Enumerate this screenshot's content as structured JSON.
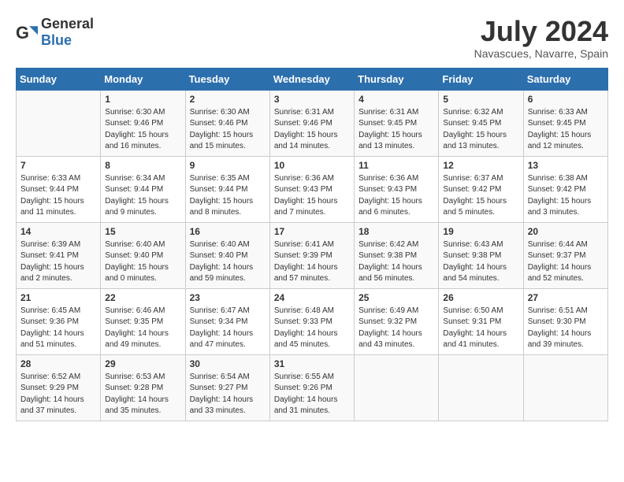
{
  "logo": {
    "text_general": "General",
    "text_blue": "Blue"
  },
  "title": "July 2024",
  "subtitle": "Navascues, Navarre, Spain",
  "days_of_week": [
    "Sunday",
    "Monday",
    "Tuesday",
    "Wednesday",
    "Thursday",
    "Friday",
    "Saturday"
  ],
  "weeks": [
    [
      {
        "day": "",
        "info": ""
      },
      {
        "day": "1",
        "info": "Sunrise: 6:30 AM\nSunset: 9:46 PM\nDaylight: 15 hours\nand 16 minutes."
      },
      {
        "day": "2",
        "info": "Sunrise: 6:30 AM\nSunset: 9:46 PM\nDaylight: 15 hours\nand 15 minutes."
      },
      {
        "day": "3",
        "info": "Sunrise: 6:31 AM\nSunset: 9:46 PM\nDaylight: 15 hours\nand 14 minutes."
      },
      {
        "day": "4",
        "info": "Sunrise: 6:31 AM\nSunset: 9:45 PM\nDaylight: 15 hours\nand 13 minutes."
      },
      {
        "day": "5",
        "info": "Sunrise: 6:32 AM\nSunset: 9:45 PM\nDaylight: 15 hours\nand 13 minutes."
      },
      {
        "day": "6",
        "info": "Sunrise: 6:33 AM\nSunset: 9:45 PM\nDaylight: 15 hours\nand 12 minutes."
      }
    ],
    [
      {
        "day": "7",
        "info": "Sunrise: 6:33 AM\nSunset: 9:44 PM\nDaylight: 15 hours\nand 11 minutes."
      },
      {
        "day": "8",
        "info": "Sunrise: 6:34 AM\nSunset: 9:44 PM\nDaylight: 15 hours\nand 9 minutes."
      },
      {
        "day": "9",
        "info": "Sunrise: 6:35 AM\nSunset: 9:44 PM\nDaylight: 15 hours\nand 8 minutes."
      },
      {
        "day": "10",
        "info": "Sunrise: 6:36 AM\nSunset: 9:43 PM\nDaylight: 15 hours\nand 7 minutes."
      },
      {
        "day": "11",
        "info": "Sunrise: 6:36 AM\nSunset: 9:43 PM\nDaylight: 15 hours\nand 6 minutes."
      },
      {
        "day": "12",
        "info": "Sunrise: 6:37 AM\nSunset: 9:42 PM\nDaylight: 15 hours\nand 5 minutes."
      },
      {
        "day": "13",
        "info": "Sunrise: 6:38 AM\nSunset: 9:42 PM\nDaylight: 15 hours\nand 3 minutes."
      }
    ],
    [
      {
        "day": "14",
        "info": "Sunrise: 6:39 AM\nSunset: 9:41 PM\nDaylight: 15 hours\nand 2 minutes."
      },
      {
        "day": "15",
        "info": "Sunrise: 6:40 AM\nSunset: 9:40 PM\nDaylight: 15 hours\nand 0 minutes."
      },
      {
        "day": "16",
        "info": "Sunrise: 6:40 AM\nSunset: 9:40 PM\nDaylight: 14 hours\nand 59 minutes."
      },
      {
        "day": "17",
        "info": "Sunrise: 6:41 AM\nSunset: 9:39 PM\nDaylight: 14 hours\nand 57 minutes."
      },
      {
        "day": "18",
        "info": "Sunrise: 6:42 AM\nSunset: 9:38 PM\nDaylight: 14 hours\nand 56 minutes."
      },
      {
        "day": "19",
        "info": "Sunrise: 6:43 AM\nSunset: 9:38 PM\nDaylight: 14 hours\nand 54 minutes."
      },
      {
        "day": "20",
        "info": "Sunrise: 6:44 AM\nSunset: 9:37 PM\nDaylight: 14 hours\nand 52 minutes."
      }
    ],
    [
      {
        "day": "21",
        "info": "Sunrise: 6:45 AM\nSunset: 9:36 PM\nDaylight: 14 hours\nand 51 minutes."
      },
      {
        "day": "22",
        "info": "Sunrise: 6:46 AM\nSunset: 9:35 PM\nDaylight: 14 hours\nand 49 minutes."
      },
      {
        "day": "23",
        "info": "Sunrise: 6:47 AM\nSunset: 9:34 PM\nDaylight: 14 hours\nand 47 minutes."
      },
      {
        "day": "24",
        "info": "Sunrise: 6:48 AM\nSunset: 9:33 PM\nDaylight: 14 hours\nand 45 minutes."
      },
      {
        "day": "25",
        "info": "Sunrise: 6:49 AM\nSunset: 9:32 PM\nDaylight: 14 hours\nand 43 minutes."
      },
      {
        "day": "26",
        "info": "Sunrise: 6:50 AM\nSunset: 9:31 PM\nDaylight: 14 hours\nand 41 minutes."
      },
      {
        "day": "27",
        "info": "Sunrise: 6:51 AM\nSunset: 9:30 PM\nDaylight: 14 hours\nand 39 minutes."
      }
    ],
    [
      {
        "day": "28",
        "info": "Sunrise: 6:52 AM\nSunset: 9:29 PM\nDaylight: 14 hours\nand 37 minutes."
      },
      {
        "day": "29",
        "info": "Sunrise: 6:53 AM\nSunset: 9:28 PM\nDaylight: 14 hours\nand 35 minutes."
      },
      {
        "day": "30",
        "info": "Sunrise: 6:54 AM\nSunset: 9:27 PM\nDaylight: 14 hours\nand 33 minutes."
      },
      {
        "day": "31",
        "info": "Sunrise: 6:55 AM\nSunset: 9:26 PM\nDaylight: 14 hours\nand 31 minutes."
      },
      {
        "day": "",
        "info": ""
      },
      {
        "day": "",
        "info": ""
      },
      {
        "day": "",
        "info": ""
      }
    ]
  ]
}
